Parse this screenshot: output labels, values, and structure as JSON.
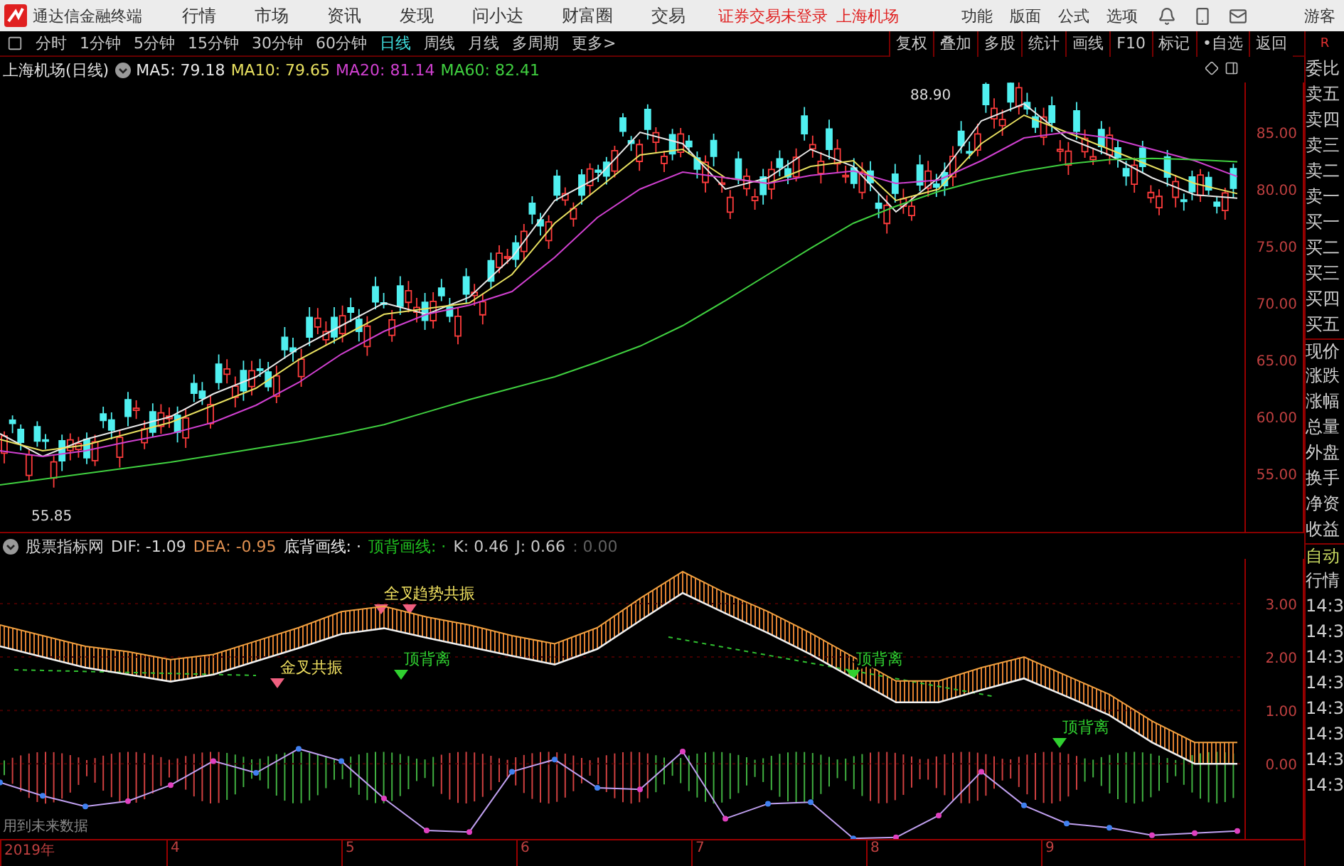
{
  "app": {
    "title": "通达信金融终端"
  },
  "menu": [
    "行情",
    "市场",
    "资讯",
    "发现",
    "问小达",
    "财富圈",
    "交易"
  ],
  "login_status": "证券交易未登录",
  "stock_name": "上海机场",
  "menu_right": [
    "功能",
    "版面",
    "公式",
    "选项"
  ],
  "user": "游客",
  "periods": [
    {
      "label": "分时",
      "selected": false
    },
    {
      "label": "1分钟",
      "selected": false
    },
    {
      "label": "5分钟",
      "selected": false
    },
    {
      "label": "15分钟",
      "selected": false
    },
    {
      "label": "30分钟",
      "selected": false
    },
    {
      "label": "60分钟",
      "selected": false
    },
    {
      "label": "日线",
      "selected": true
    },
    {
      "label": "周线",
      "selected": false
    },
    {
      "label": "月线",
      "selected": false
    },
    {
      "label": "多周期",
      "selected": false
    },
    {
      "label": "更多>",
      "selected": false
    }
  ],
  "tools": [
    "复权",
    "叠加",
    "多股",
    "统计",
    "画线",
    "F10",
    "标记",
    "•自选",
    "返回"
  ],
  "toolbar_mark": "R",
  "price_chart": {
    "title": "上海机场(日线)",
    "ma": [
      {
        "label": "MA5: 79.18"
      },
      {
        "label": "MA10: 79.65"
      },
      {
        "label": "MA20: 81.14"
      },
      {
        "label": "MA60: 82.41"
      }
    ],
    "high_label": "88.90",
    "low_label": "55.85",
    "chart_data": {
      "type": "line",
      "ylim": [
        49.75,
        89.38
      ],
      "yticks": [
        {
          "value": 85,
          "label": "85.00"
        },
        {
          "value": 80,
          "label": "80.00"
        },
        {
          "value": 75,
          "label": "75.00"
        },
        {
          "value": 70,
          "label": "70.00"
        },
        {
          "value": 65,
          "label": "65.00"
        },
        {
          "value": 60,
          "label": "60.00"
        },
        {
          "value": 55,
          "label": "55.00"
        }
      ],
      "series": [
        {
          "color": "#e8e8e8",
          "values": [
            58.5,
            56.5,
            58,
            59,
            60,
            62,
            63.5,
            66,
            68,
            70,
            69,
            70.5,
            74,
            79,
            81,
            85,
            84,
            80,
            81,
            83.5,
            82,
            78,
            81,
            86,
            87.5,
            84.5,
            83,
            81,
            79.5,
            79.2
          ]
        },
        {
          "color": "#e8e060",
          "values": [
            58,
            57,
            57.5,
            58.5,
            59.5,
            61,
            62.5,
            65,
            67,
            69,
            69.5,
            70,
            72.5,
            77,
            80,
            83,
            83.5,
            81,
            80.5,
            82,
            82.5,
            79,
            80,
            84,
            86.5,
            85,
            83.5,
            82,
            80.5,
            79.6
          ]
        },
        {
          "color": "#d040d0",
          "values": [
            57,
            56.5,
            57,
            57.8,
            58.5,
            59.5,
            61,
            63,
            65.5,
            67.5,
            69,
            69.8,
            71,
            74,
            77.5,
            80,
            81.5,
            81,
            80.5,
            81.2,
            81.6,
            80.5,
            80.8,
            82.5,
            84.5,
            85,
            84.5,
            83.5,
            82.5,
            81.1
          ]
        },
        {
          "color": "#40d040",
          "values": [
            54,
            54.5,
            55,
            55.5,
            56,
            56.6,
            57.2,
            57.8,
            58.5,
            59.3,
            60.4,
            61.5,
            62.5,
            63.5,
            64.8,
            66.2,
            68,
            70.2,
            72.5,
            74.8,
            77,
            78.5,
            79.8,
            80.8,
            81.6,
            82.2,
            82.6,
            82.7,
            82.6,
            82.4
          ]
        }
      ]
    }
  },
  "indicator": {
    "title": "股票指标网",
    "values": [
      {
        "label": "DIF: -1.09",
        "color": "#d8d8d8"
      },
      {
        "label": "DEA: -0.95",
        "color": "#e09050"
      },
      {
        "label": "底背画线: ·",
        "color": "#e8e8e8"
      },
      {
        "label": "顶背画线: ·",
        "color": "#20c020"
      },
      {
        "label": "K: 0.46",
        "color": "#c8c8c8"
      },
      {
        "label": "J: 0.66",
        "color": "#c8c8c8"
      },
      {
        "label": ": 0.00",
        "color": "#606060"
      }
    ],
    "chart_data": {
      "type": "line",
      "ylim": [
        -1.41,
        3.84
      ],
      "grid": true,
      "yticks": [
        {
          "value": 3,
          "label": "3.00"
        },
        {
          "value": 2,
          "label": "2.00"
        },
        {
          "value": 1,
          "label": "1.00"
        },
        {
          "value": 0,
          "label": "0.00"
        }
      ],
      "series": [
        {
          "color": "#f0f0f0",
          "values": [
            2.2,
            2.0,
            1.8,
            1.67,
            1.54,
            1.67,
            1.92,
            2.17,
            2.43,
            2.54,
            2.36,
            2.19,
            2.02,
            1.86,
            2.15,
            2.68,
            3.2,
            2.82,
            2.45,
            2.05,
            1.6,
            1.15,
            1.15,
            1.38,
            1.6,
            1.26,
            0.91,
            0.4,
            0,
            0
          ]
        },
        {
          "color": "#f0a040",
          "values": [
            2.6,
            2.4,
            2.2,
            2.1,
            1.95,
            2.05,
            2.3,
            2.55,
            2.85,
            2.95,
            2.75,
            2.6,
            2.4,
            2.25,
            2.55,
            3.1,
            3.6,
            3.2,
            2.85,
            2.45,
            2.0,
            1.55,
            1.55,
            1.8,
            2.0,
            1.65,
            1.3,
            0.8,
            0.4,
            0.4
          ]
        },
        {
          "color": "#c0a0f0",
          "marker": "o",
          "values": [
            -0.35,
            -0.6,
            -0.8,
            -0.7,
            -0.4,
            0.05,
            -0.17,
            0.28,
            0.05,
            -0.65,
            -1.25,
            -1.28,
            -0.15,
            0.08,
            -0.45,
            -0.48,
            0.23,
            -1.03,
            -0.75,
            -0.72,
            -1.4,
            -1.38,
            -0.97,
            -0.15,
            -0.78,
            -1.12,
            -1.2,
            -1.34,
            -1.3,
            -1.26
          ]
        }
      ]
    },
    "signals": [
      {
        "text": "全叉",
        "color": "#f0e060"
      },
      {
        "text": "趋势共振",
        "color": "#f0e060"
      },
      {
        "text": "顶背离",
        "color": "#30d030"
      },
      {
        "text": "金叉共振",
        "color": "#f0e060"
      },
      {
        "text": "顶背离",
        "color": "#30d030"
      },
      {
        "text": "顶背离",
        "color": "#30d030"
      }
    ],
    "note": "用到未来数据"
  },
  "time_axis": [
    "2019年",
    "4",
    "5",
    "6",
    "7",
    "8",
    "9"
  ],
  "quote_panel": [
    "委比",
    "卖五",
    "卖四",
    "卖三",
    "卖二",
    "卖一",
    "买一",
    "买二",
    "买三",
    "买四",
    "买五",
    "现价",
    "涨跌",
    "涨幅",
    "总量",
    "外盘",
    "换手",
    "净资",
    "收益",
    "自动",
    "行情",
    "14:3",
    "14:3",
    "14:3",
    "14:3",
    "14:3",
    "14:3",
    "14:3",
    "14:3"
  ]
}
